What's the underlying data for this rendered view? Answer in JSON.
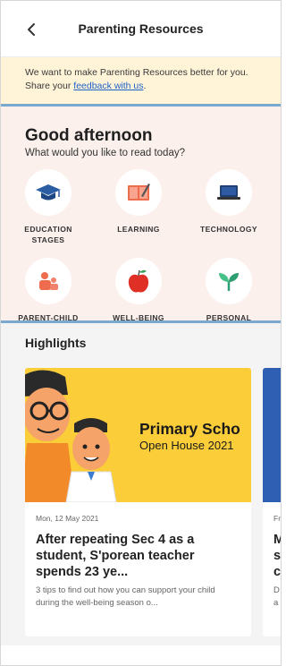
{
  "header": {
    "title": "Parenting Resources",
    "back_icon": "chevron-left-icon"
  },
  "banner": {
    "text_before": "We want to make Parenting Resources better for you. Share your ",
    "link_text": "feedback with us",
    "text_after": "."
  },
  "greeting": {
    "title": "Good afternoon",
    "subtitle": "What would you like to read today?"
  },
  "categories": [
    {
      "label": "EDUCATION STAGES",
      "icon": "graduation-cap-icon"
    },
    {
      "label": "LEARNING",
      "icon": "open-book-icon"
    },
    {
      "label": "TECHNOLOGY",
      "icon": "laptop-icon"
    },
    {
      "label": "PARENT-CHILD RELATIONSHIP",
      "icon": "parent-child-icon"
    },
    {
      "label": "WELL-BEING",
      "icon": "apple-icon"
    },
    {
      "label": "PERSONAL GROWTH",
      "icon": "sprout-icon"
    }
  ],
  "highlights": {
    "title": "Highlights",
    "cards": [
      {
        "image_title": "Primary Scho",
        "image_subtitle": "Open House 2021",
        "date": "Mon, 12 May 2021",
        "headline": "After repeating Sec 4 as a student, S'porean teacher spends 23 ye...",
        "description": "3 tips to find out how you can support your child during the well-being season o..."
      },
      {
        "date": "Fr",
        "headline": "M s c",
        "description": "D a"
      }
    ]
  },
  "colors": {
    "banner_bg": "#fff3d8",
    "greeting_bg": "#fbf0ec",
    "link": "#1f63c9",
    "divider": "#7aa9cf",
    "promo_yellow": "#fbcd38"
  }
}
